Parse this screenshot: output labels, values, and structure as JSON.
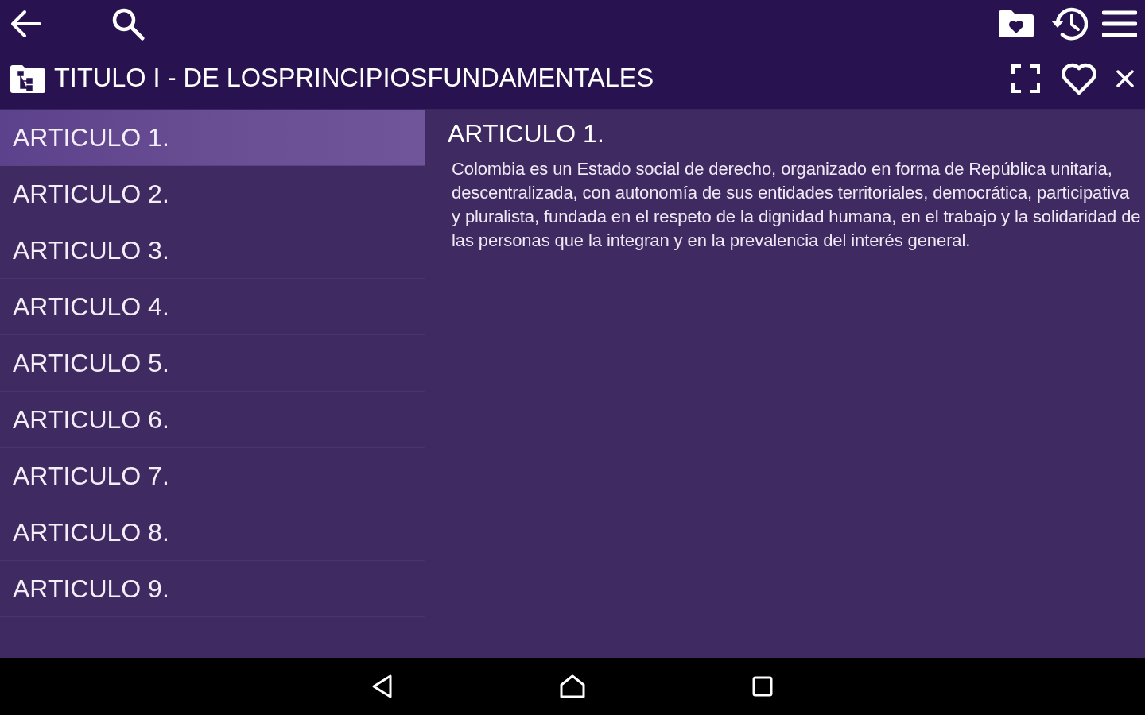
{
  "header": {
    "title": "TITULO I - DE LOSPRINCIPIOSFUNDAMENTALES"
  },
  "articles": [
    {
      "label": "ARTICULO 1.",
      "selected": true
    },
    {
      "label": "ARTICULO 2.",
      "selected": false
    },
    {
      "label": "ARTICULO 3.",
      "selected": false
    },
    {
      "label": "ARTICULO 4.",
      "selected": false
    },
    {
      "label": "ARTICULO 5.",
      "selected": false
    },
    {
      "label": "ARTICULO 6.",
      "selected": false
    },
    {
      "label": "ARTICULO 7.",
      "selected": false
    },
    {
      "label": "ARTICULO 8.",
      "selected": false
    },
    {
      "label": "ARTICULO 9.",
      "selected": false
    }
  ],
  "detail": {
    "heading": "ARTICULO 1.",
    "body": "Colombia es un Estado social de derecho, organizado en forma de República unitaria, descentralizada, con autonomía de sus entidades territoriales, democrática, participativa y pluralista, fundada en el respeto de la dignidad humana, en el trabajo y la solidaridad de las personas que la integran y en la prevalencia del interés general."
  }
}
